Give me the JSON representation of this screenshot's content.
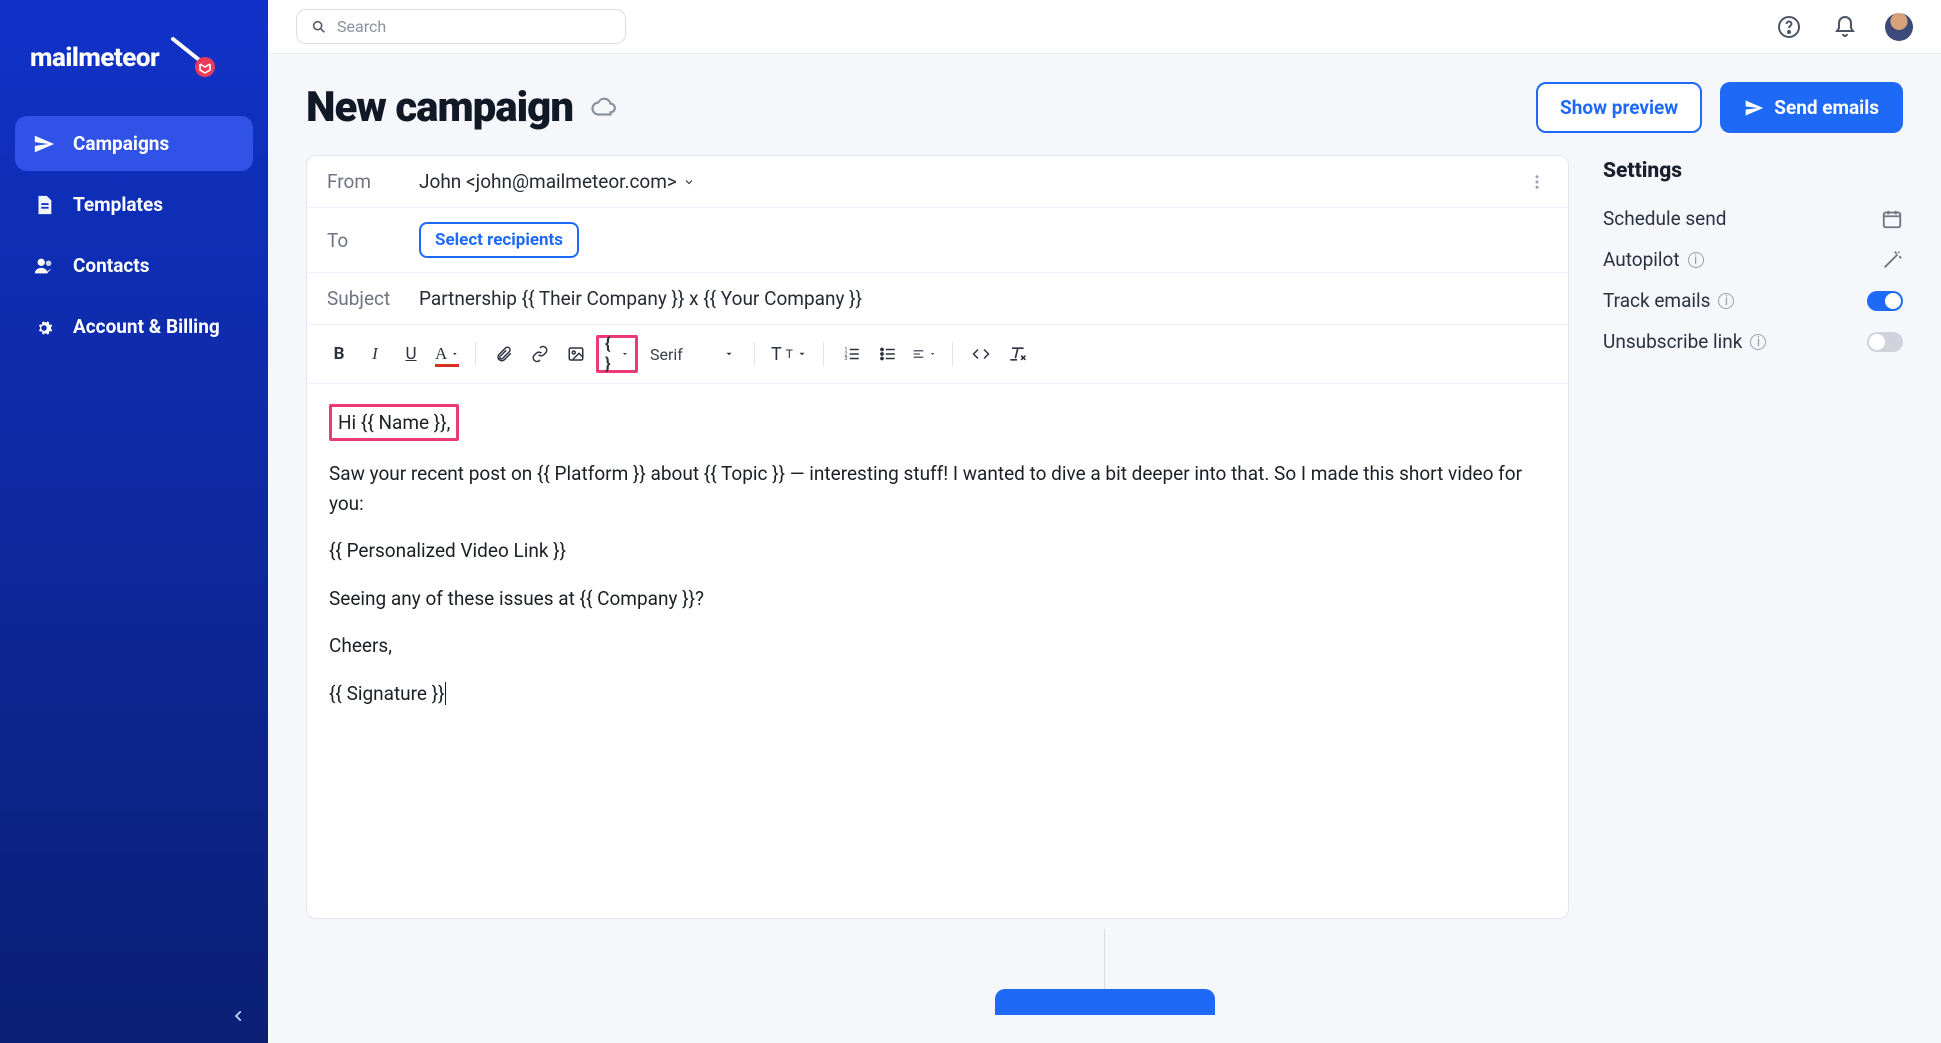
{
  "app": {
    "name": "mailmeteor"
  },
  "nav": {
    "items": [
      {
        "label": "Campaigns"
      },
      {
        "label": "Templates"
      },
      {
        "label": "Contacts"
      },
      {
        "label": "Account & Billing"
      }
    ]
  },
  "search": {
    "placeholder": "Search"
  },
  "header": {
    "title": "New campaign",
    "preview_btn": "Show preview",
    "send_btn": "Send emails"
  },
  "compose": {
    "from_label": "From",
    "from_value": "John <john@mailmeteor.com>",
    "to_label": "To",
    "select_recipients": "Select recipients",
    "subject_label": "Subject",
    "subject_value": "Partnership {{ Their Company }} x {{ Your Company }}"
  },
  "toolbar": {
    "font": "Serif"
  },
  "body": {
    "p1": "Hi {{ Name }},",
    "p2": "Saw your recent post on {{ Platform }} about {{ Topic }} — interesting stuff! I wanted to dive a bit deeper into that. So I made this short video for you:",
    "p3": "{{ Personalized Video Link }}",
    "p4": "Seeing any of these issues at {{ Company }}?",
    "p5": "Cheers,",
    "p6": "{{ Signature }}"
  },
  "settings": {
    "title": "Settings",
    "schedule": "Schedule send",
    "autopilot": "Autopilot",
    "track": "Track emails",
    "unsubscribe": "Unsubscribe link",
    "track_on": true,
    "unsubscribe_on": false
  }
}
